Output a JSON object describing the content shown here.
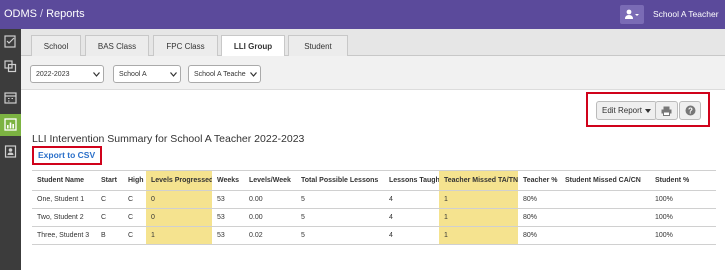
{
  "header": {
    "app": "ODMS",
    "separator": "/",
    "page": "Reports",
    "user_name": "School A Teacher"
  },
  "sidebar": {
    "items": [
      {
        "icon": "checklist-icon",
        "active": false
      },
      {
        "icon": "copy-icon",
        "active": false
      },
      {
        "icon": "calendar-icon",
        "active": false
      },
      {
        "icon": "chart-icon",
        "active": true
      },
      {
        "icon": "contact-icon",
        "active": false
      }
    ]
  },
  "tabs": [
    "School",
    "BAS Class",
    "FPC Class",
    "LLI Group",
    "Student"
  ],
  "active_tab": "LLI Group",
  "filters": {
    "year": "2022-2023",
    "school": "School A",
    "teacher": "School A Teache"
  },
  "actions": {
    "edit_report": "Edit Report",
    "print_icon": "print-icon",
    "help_icon": "help-icon"
  },
  "report": {
    "title": "LLI Intervention Summary for School A Teacher 2022-2023",
    "export_label": "Export to CSV"
  },
  "table": {
    "headers": [
      "Student Name",
      "Start",
      "High",
      "Levels Progressed",
      "Weeks",
      "Levels/Week",
      "Total Possible Lessons",
      "Lessons Taught",
      "Teacher Missed TA/TN",
      "Teacher %",
      "Student Missed CA/CN",
      "Student %"
    ],
    "rows": [
      [
        "One, Student 1",
        "C",
        "C",
        "0",
        "53",
        "0.00",
        "5",
        "4",
        "1",
        "80%",
        "",
        "100%"
      ],
      [
        "Two, Student 2",
        "C",
        "C",
        "0",
        "53",
        "0.00",
        "5",
        "4",
        "1",
        "80%",
        "",
        "100%"
      ],
      [
        "Three, Student 3",
        "B",
        "C",
        "1",
        "53",
        "0.02",
        "5",
        "4",
        "1",
        "80%",
        "",
        "100%"
      ]
    ],
    "highlight_color": "#f5e38f"
  }
}
